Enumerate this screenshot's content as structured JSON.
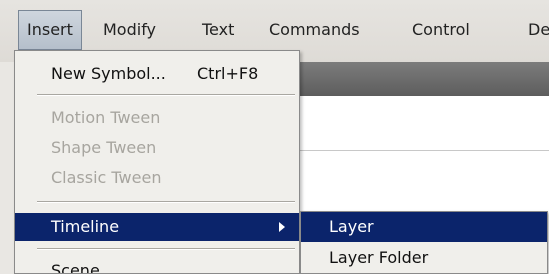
{
  "menubar": {
    "items": [
      {
        "label": "Insert",
        "active": true
      },
      {
        "label": "Modify"
      },
      {
        "label": "Text"
      },
      {
        "label": "Commands"
      },
      {
        "label": "Control"
      },
      {
        "label": "De"
      }
    ]
  },
  "insert_menu": {
    "new_symbol": {
      "label": "New Symbol...",
      "shortcut": "Ctrl+F8"
    },
    "motion_tween": {
      "label": "Motion Tween"
    },
    "shape_tween": {
      "label": "Shape Tween"
    },
    "classic_tween": {
      "label": "Classic Tween"
    },
    "timeline": {
      "label": "Timeline"
    },
    "scene": {
      "label": "Scene"
    }
  },
  "timeline_submenu": {
    "layer": {
      "label": "Layer"
    },
    "layer_folder": {
      "label": "Layer Folder"
    }
  },
  "colors": {
    "highlight": "#0b246b",
    "disabled_text": "#a7a59f",
    "menu_background": "#f0efeb"
  }
}
